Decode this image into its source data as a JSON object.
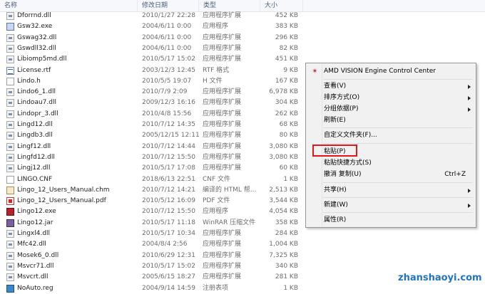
{
  "header": {
    "col_name": "名称",
    "col_date": "修改日期",
    "col_type": "类型",
    "col_size": "大小"
  },
  "files": [
    {
      "name": "Dforrnd.dll",
      "date": "2010/1/27 22:28",
      "type": "应用程序扩展",
      "size": "452 KB",
      "icon": "dll-icon"
    },
    {
      "name": "Gsw32.exe",
      "date": "2004/6/11 0:00",
      "type": "应用程序",
      "size": "383 KB",
      "icon": "exe-icon"
    },
    {
      "name": "Gswag32.dll",
      "date": "2004/6/11 0:00",
      "type": "应用程序扩展",
      "size": "296 KB",
      "icon": "dll-icon"
    },
    {
      "name": "Gswdll32.dll",
      "date": "2004/6/11 0:00",
      "type": "应用程序扩展",
      "size": "82 KB",
      "icon": "dll-icon"
    },
    {
      "name": "Libiomp5md.dll",
      "date": "2010/5/17 15:02",
      "type": "应用程序扩展",
      "size": "451 KB",
      "icon": "dll-icon"
    },
    {
      "name": "License.rtf",
      "date": "2003/12/3 12:45",
      "type": "RTF 格式",
      "size": "9 KB",
      "icon": "rtf-icon"
    },
    {
      "name": "Lindo.h",
      "date": "2010/5/5 19:07",
      "type": "H 文件",
      "size": "167 KB",
      "icon": "h-file-icon"
    },
    {
      "name": "Lindo6_1.dll",
      "date": "2010/7/9 2:09",
      "type": "应用程序扩展",
      "size": "6,978 KB",
      "icon": "dll-icon"
    },
    {
      "name": "Lindoau7.dll",
      "date": "2009/12/3 16:16",
      "type": "应用程序扩展",
      "size": "304 KB",
      "icon": "dll-icon"
    },
    {
      "name": "Lindopr_3.dll",
      "date": "2010/4/8 15:56",
      "type": "应用程序扩展",
      "size": "262 KB",
      "icon": "dll-icon"
    },
    {
      "name": "Lingd12.dll",
      "date": "2010/7/12 14:35",
      "type": "应用程序扩展",
      "size": "68 KB",
      "icon": "dll-icon"
    },
    {
      "name": "Lingdb3.dll",
      "date": "2005/12/15 12:11",
      "type": "应用程序扩展",
      "size": "80 KB",
      "icon": "dll-icon"
    },
    {
      "name": "Lingf12.dll",
      "date": "2010/7/12 14:44",
      "type": "应用程序扩展",
      "size": "3,080 KB",
      "icon": "dll-icon"
    },
    {
      "name": "Lingfd12.dll",
      "date": "2010/7/12 15:50",
      "type": "应用程序扩展",
      "size": "3,080 KB",
      "icon": "dll-icon"
    },
    {
      "name": "Lingj12.dll",
      "date": "2010/5/17 17:08",
      "type": "应用程序扩展",
      "size": "60 KB",
      "icon": "dll-icon"
    },
    {
      "name": "LINGO.CNF",
      "date": "2018/6/13 22:51",
      "type": "CNF 文件",
      "size": "1 KB",
      "icon": "cnf-file-icon"
    },
    {
      "name": "Lingo_12_Users_Manual.chm",
      "date": "2010/7/12 14:21",
      "type": "编译的 HTML 帮...",
      "size": "2,513 KB",
      "icon": "chm-icon"
    },
    {
      "name": "Lingo_12_Users_Manual.pdf",
      "date": "2010/5/12 16:09",
      "type": "PDF 文件",
      "size": "3,544 KB",
      "icon": "pdf-icon"
    },
    {
      "name": "Lingo12.exe",
      "date": "2010/7/12 15:50",
      "type": "应用程序",
      "size": "4,054 KB",
      "icon": "lingo-app-icon"
    },
    {
      "name": "Lingo12.jar",
      "date": "2010/5/17 11:18",
      "type": "WinRAR 压缩文件",
      "size": "358 KB",
      "icon": "jar-icon"
    },
    {
      "name": "Lingxl4.dll",
      "date": "2010/5/17 10:34",
      "type": "应用程序扩展",
      "size": "284 KB",
      "icon": "dll-icon"
    },
    {
      "name": "Mfc42.dll",
      "date": "2004/8/4 2:56",
      "type": "应用程序扩展",
      "size": "1,004 KB",
      "icon": "dll-icon"
    },
    {
      "name": "Mosek6_0.dll",
      "date": "2010/6/29 12:31",
      "type": "应用程序扩展",
      "size": "7,325 KB",
      "icon": "dll-icon"
    },
    {
      "name": "Msvcr71.dll",
      "date": "2010/5/17 15:02",
      "type": "应用程序扩展",
      "size": "340 KB",
      "icon": "dll-icon"
    },
    {
      "name": "Msvcrt.dll",
      "date": "2005/6/15 18:27",
      "type": "应用程序扩展",
      "size": "281 KB",
      "icon": "dll-icon"
    },
    {
      "name": "NoAuto.reg",
      "date": "2004/9/14 14:59",
      "type": "注册表项",
      "size": "1 KB",
      "icon": "reg-icon"
    }
  ],
  "context_menu": {
    "items": [
      {
        "label": "AMD VISION Engine Control Center",
        "shortcut": "",
        "submenu": false,
        "icon": "amd-icon"
      },
      {
        "label": "查看(V)",
        "shortcut": "",
        "submenu": true
      },
      {
        "label": "排序方式(O)",
        "shortcut": "",
        "submenu": true
      },
      {
        "label": "分组依据(P)",
        "shortcut": "",
        "submenu": true
      },
      {
        "label": "刷新(E)",
        "shortcut": "",
        "submenu": false
      },
      {
        "label": "自定义文件夹(F)...",
        "shortcut": "",
        "submenu": false
      },
      {
        "label": "粘贴(P)",
        "shortcut": "",
        "submenu": false
      },
      {
        "label": "粘贴快捷方式(S)",
        "shortcut": "",
        "submenu": false
      },
      {
        "label": "撤消 复制(U)",
        "shortcut": "Ctrl+Z",
        "submenu": false
      },
      {
        "label": "共享(H)",
        "shortcut": "",
        "submenu": true
      },
      {
        "label": "新建(W)",
        "shortcut": "",
        "submenu": true
      },
      {
        "label": "属性(R)",
        "shortcut": "",
        "submenu": false
      }
    ]
  },
  "watermark": "zhanshaoyi.com",
  "colors": {
    "highlight_border": "#e3161b",
    "watermark": "#2273c8",
    "amd_icon": "#cc2222"
  }
}
